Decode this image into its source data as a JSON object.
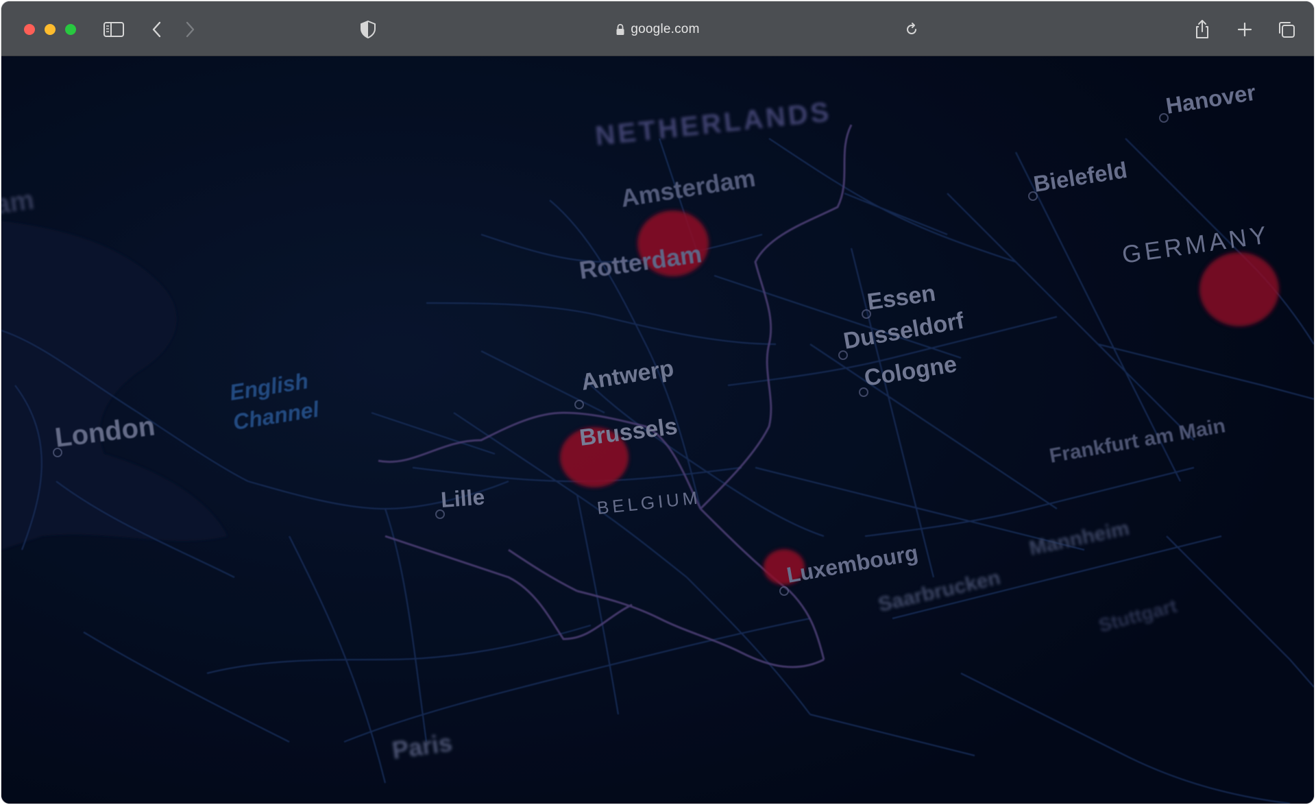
{
  "browser": {
    "url": "google.com"
  },
  "map": {
    "labels": {
      "netherlands": "NETHERLANDS",
      "amsterdam": "Amsterdam",
      "rotterdam": "Rotterdam",
      "antwerp": "Antwerp",
      "brussels": "Brussels",
      "belgium": "BELGIUM",
      "lille": "Lille",
      "luxembourg": "Luxembourg",
      "essen": "Essen",
      "dusseldorf": "Dusseldorf",
      "cologne": "Cologne",
      "bielefeld": "Bielefeld",
      "hanover": "Hanover",
      "germany": "GERMANY",
      "frankfurt": "Frankfurt am Main",
      "mannheim": "Mannheim",
      "saarbrucken": "Saarbrucken",
      "stuttgart": "Stuttgart",
      "london": "London",
      "english": "English",
      "channel": "Channel",
      "paris": "Paris",
      "partial_left": "am"
    },
    "colors": {
      "background": "#03091a",
      "roads": "#1c3566",
      "border": "#5a4a86",
      "hotspot": "#b0122a",
      "label": "#8e96b4"
    }
  }
}
